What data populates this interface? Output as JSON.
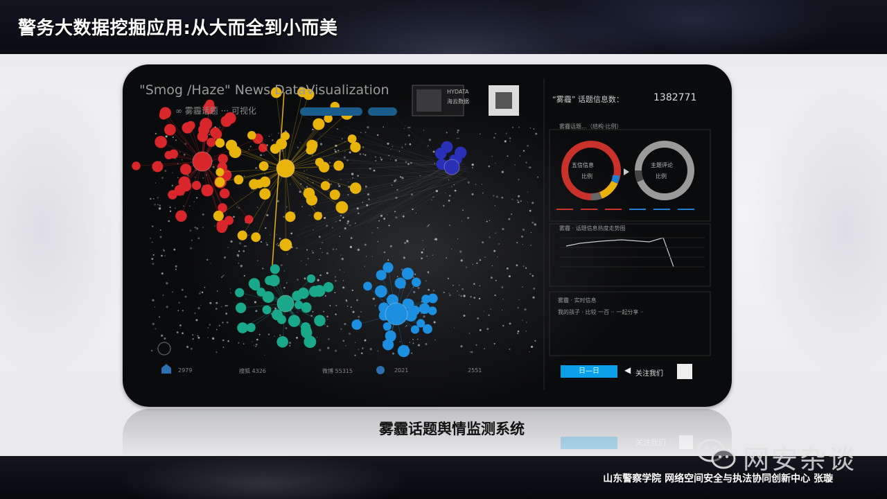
{
  "slide": {
    "title": "警务大数据挖掘应用:从大而全到小而美",
    "caption": "雾霾话题舆情监测系统",
    "footer": "山东警察学院 网络空间安全与执法协同创新中心 张璇",
    "watermark": "网安杂谈"
  },
  "viz": {
    "title": "\"Smog /Haze\" News DataVisualization",
    "subtitle": "∞  雾霾话题 ··· 可视化",
    "brand_top": "HYDATA",
    "brand_bottom": "海云数据",
    "count_label": "“雾霾” 话题信息数：",
    "count_value": "1382771",
    "panel1_title": "雾霾话题…（结构·比例）",
    "donut1_line1": "五信信息",
    "donut1_line2": "比例",
    "donut2_line1": "主题评论",
    "donut2_line2": "比例",
    "panel2_title": "雾霾 · 话题信息热度走势图",
    "panel3_title": "雾霾 · 实时信息",
    "panel3_text": "我的孩子 · 比较 一百 ·· 一起分享 ··",
    "date_button": "日—日",
    "follow_text": "关注我们",
    "stats": [
      "2979",
      "搜狐  4326",
      "微博  55315",
      "2021",
      "2551"
    ],
    "colors": {
      "red": "#d8262b",
      "yellow": "#e8b40c",
      "teal": "#1aa88a",
      "blue": "#1d8fe0",
      "navy": "#2a2fb8",
      "accent": "#0aa0e8"
    }
  }
}
